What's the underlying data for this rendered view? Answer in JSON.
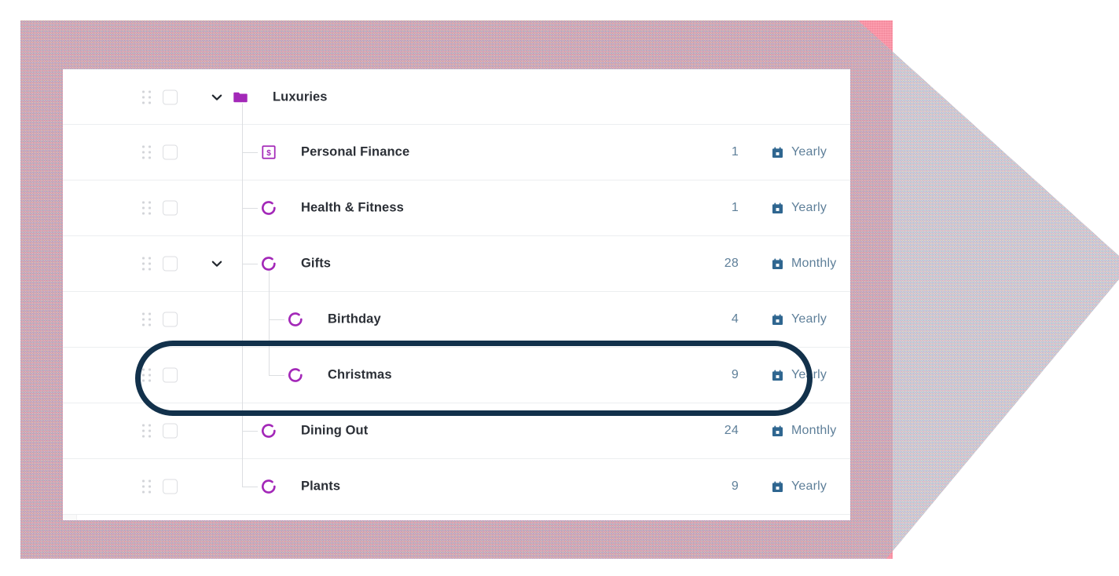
{
  "background": {
    "accent_pink": "#fb8a9e",
    "noise_panel": "noise-texture-panel"
  },
  "annotation": {
    "shape": "rounded-rectangle-outline",
    "color": "#12314b",
    "targets_row_label": "Christmas"
  },
  "card": {
    "columns": {
      "drag": "drag-handle",
      "select": "row-checkbox",
      "expand": "expand-chevron",
      "name": "category-name",
      "count": "transaction-count",
      "period": "budget-period"
    },
    "rows": [
      {
        "label": "Luxuries",
        "icon": "folder-icon",
        "icon_color": "#a328b8",
        "depth": 0,
        "expandable": true,
        "expanded": true,
        "count": "",
        "period": "",
        "checked": false
      },
      {
        "label": "Personal Finance",
        "icon": "money-bill-icon",
        "icon_color": "#a328b8",
        "depth": 1,
        "expandable": false,
        "expanded": false,
        "count": "1",
        "period": "Yearly",
        "checked": false
      },
      {
        "label": "Health & Fitness",
        "icon": "donut-chart-icon",
        "icon_color": "#a328b8",
        "depth": 1,
        "expandable": false,
        "expanded": false,
        "count": "1",
        "period": "Yearly",
        "checked": false
      },
      {
        "label": "Gifts",
        "icon": "donut-chart-icon",
        "icon_color": "#a328b8",
        "depth": 1,
        "expandable": true,
        "expanded": true,
        "count": "28",
        "period": "Monthly",
        "checked": false
      },
      {
        "label": "Birthday",
        "icon": "donut-chart-icon",
        "icon_color": "#a328b8",
        "depth": 2,
        "expandable": false,
        "expanded": false,
        "count": "4",
        "period": "Yearly",
        "checked": false
      },
      {
        "label": "Christmas",
        "icon": "donut-chart-icon",
        "icon_color": "#a328b8",
        "depth": 2,
        "expandable": false,
        "expanded": false,
        "count": "9",
        "period": "Yearly",
        "checked": false
      },
      {
        "label": "Dining Out",
        "icon": "donut-chart-icon",
        "icon_color": "#a328b8",
        "depth": 1,
        "expandable": false,
        "expanded": false,
        "count": "24",
        "period": "Monthly",
        "checked": false
      },
      {
        "label": "Plants",
        "icon": "donut-chart-icon",
        "icon_color": "#a328b8",
        "depth": 1,
        "expandable": false,
        "expanded": false,
        "count": "9",
        "period": "Yearly",
        "checked": false
      }
    ]
  },
  "colors": {
    "row_label": "#2b2f36",
    "meta_text": "#5e7f99",
    "icon_purple": "#a328b8",
    "calendar_blue": "#2f6690",
    "row_divider": "#eceef0"
  }
}
